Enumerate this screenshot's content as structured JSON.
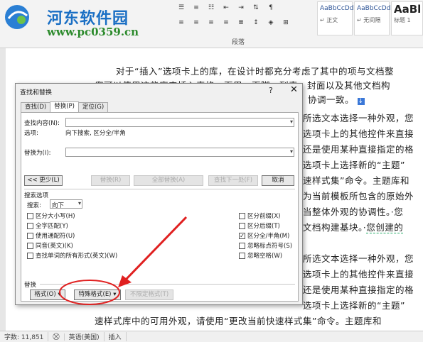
{
  "watermark": {
    "title": "河东软件园",
    "url": "www.pc0359.cn"
  },
  "ribbon": {
    "paragraph_group_label": "段落",
    "styles": [
      {
        "sample": "AaBbCcDd",
        "name": "↵ 正文"
      },
      {
        "sample": "AaBbCcDd",
        "name": "↵ 无间隔"
      },
      {
        "sample": "AaBl",
        "name": "标题 1"
      }
    ]
  },
  "document": {
    "lines": [
      "对于“插入”选项卡上的库，在设计时都充分考虑了其中的项与文档整",
      "您可以使用这些库来插入表格、页眉、页脚、列表、封面以及其他文档构",
      "协调一致。",
      "所选文本选择一种外观，您",
      "选项卡上的其他控件来直接",
      "还是使用某种直接指定的格",
      "选项卡上选择新的“主题”",
      "速样式集”命令。主题库和",
      "为当前模板所包含的原始外",
      "当整体外观的协调性。·您",
      "文档构建基块。·",
      "您创建的",
      "所选文本选择一种外观，您",
      "选项卡上的其他控件来直接",
      "还是使用某种直接指定的格",
      "选项卡上选择新的“主题”",
      "速样式库中的可用外观，请使用“更改当前快速样式集”命令。主题库和"
    ],
    "cursor_mark": "↓"
  },
  "status_bar": {
    "words": "字数: 11,851",
    "language": "英语(美国)",
    "mode": "插入"
  },
  "dialog": {
    "title": "查找和替换",
    "help": "?",
    "close": "✕",
    "tabs": [
      "查找(D)",
      "替换(P)",
      "定位(G)"
    ],
    "active_tab": 1,
    "find_label": "查找内容(N):",
    "options_label": "选项:",
    "options_value": "向下搜索, 区分全/半角",
    "replace_label": "替换为(I):",
    "buttons": {
      "less": "<< 更少(L)",
      "replace": "替换(R)",
      "replace_all": "全部替换(A)",
      "find_next": "查找下一处(F)",
      "cancel": "取消"
    },
    "search_options_title": "搜索选项",
    "search_label": "搜索:",
    "search_value": "向下",
    "left_checks": [
      {
        "label": "区分大小写(H)",
        "checked": false,
        "enabled": true
      },
      {
        "label": "全字匹配(Y)",
        "checked": false,
        "enabled": true
      },
      {
        "label": "使用通配符(U)",
        "checked": false,
        "enabled": true
      },
      {
        "label": "同音(英文)(K)",
        "checked": false,
        "enabled": true
      },
      {
        "label": "查找单词的所有形式(英文)(W)",
        "checked": false,
        "enabled": true
      }
    ],
    "right_checks": [
      {
        "label": "区分前缀(X)",
        "checked": false,
        "enabled": true
      },
      {
        "label": "区分后缀(T)",
        "checked": false,
        "enabled": true
      },
      {
        "label": "区分全/半角(M)",
        "checked": true,
        "enabled": true
      },
      {
        "label": "忽略标点符号(S)",
        "checked": false,
        "enabled": true
      },
      {
        "label": "忽略空格(W)",
        "checked": false,
        "enabled": true
      }
    ],
    "replace_section_title": "替换",
    "format_button": "格式(O) ▾",
    "special_button": "特殊格式(E) ▾",
    "no_format_button": "不限定格式(T)"
  },
  "colors": {
    "annotation": "#e02020",
    "watermark_title": "#1a6fc4",
    "watermark_url": "#2b8a2b"
  }
}
